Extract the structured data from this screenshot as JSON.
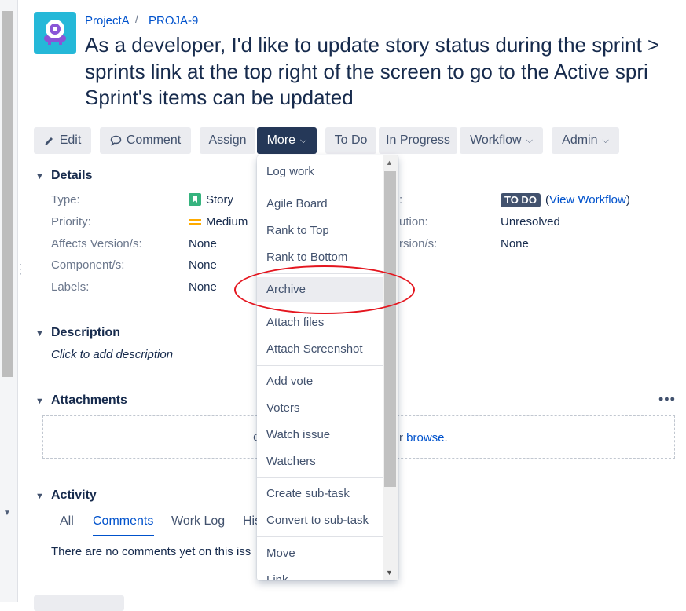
{
  "breadcrumb": {
    "project": "ProjectA",
    "separator": "/",
    "issue_key": "PROJA-9"
  },
  "title_lines": [
    "As a developer, I'd like to update story status during the sprint >",
    "sprints link at the top right of the screen to go to the Active spri",
    "Sprint's items can be updated"
  ],
  "toolbar": {
    "edit": "Edit",
    "comment": "Comment",
    "assign": "Assign",
    "more": "More",
    "todo": "To Do",
    "in_progress": "In Progress",
    "workflow": "Workflow",
    "admin": "Admin"
  },
  "details": {
    "title": "Details",
    "type_label": "Type:",
    "type_value": "Story",
    "priority_label": "Priority:",
    "priority_value": "Medium",
    "affects_label": "Affects Version/s:",
    "affects_value": "None",
    "component_label": "Component/s:",
    "component_value": "None",
    "labels_label": "Labels:",
    "labels_value": "None",
    "status_label_partial": ":",
    "status_lozenge": "TO DO",
    "status_open": "(",
    "status_link": "View Workflow",
    "status_close": ")",
    "resolution_label_partial": "ution:",
    "resolution_value": "Unresolved",
    "fix_label_partial": "rsion/s:",
    "fix_value": "None"
  },
  "description": {
    "title": "Description",
    "placeholder": "Click to add description"
  },
  "attachments": {
    "title": "Attachments",
    "more": "•••",
    "drop_left_partial": "C",
    "drop_right_partial": "r",
    "browse": "browse",
    "period": "."
  },
  "activity": {
    "title": "Activity",
    "tabs": [
      "All",
      "Comments",
      "Work Log",
      "His"
    ],
    "empty": "There are no comments yet on this iss"
  },
  "more_menu": {
    "items": [
      "Log work",
      "Agile Board",
      "Rank to Top",
      "Rank to Bottom",
      "Archive",
      "Attach files",
      "Attach Screenshot",
      "Add vote",
      "Voters",
      "Watch issue",
      "Watchers",
      "Create sub-task",
      "Convert to sub-task",
      "Move",
      "Link"
    ],
    "highlighted": "Archive"
  },
  "colors": {
    "link": "#0052cc",
    "more_button_bg": "#253858",
    "lozenge_bg": "#42526e",
    "annotation": "#e4161f",
    "story_icon": "#36b37e",
    "priority_icon": "#ffab00",
    "project_avatar": "#25b8d8"
  },
  "icons": {
    "edit": "pencil-icon",
    "comment": "speech-bubble-icon",
    "story": "story-icon",
    "priority": "priority-medium-icon"
  }
}
